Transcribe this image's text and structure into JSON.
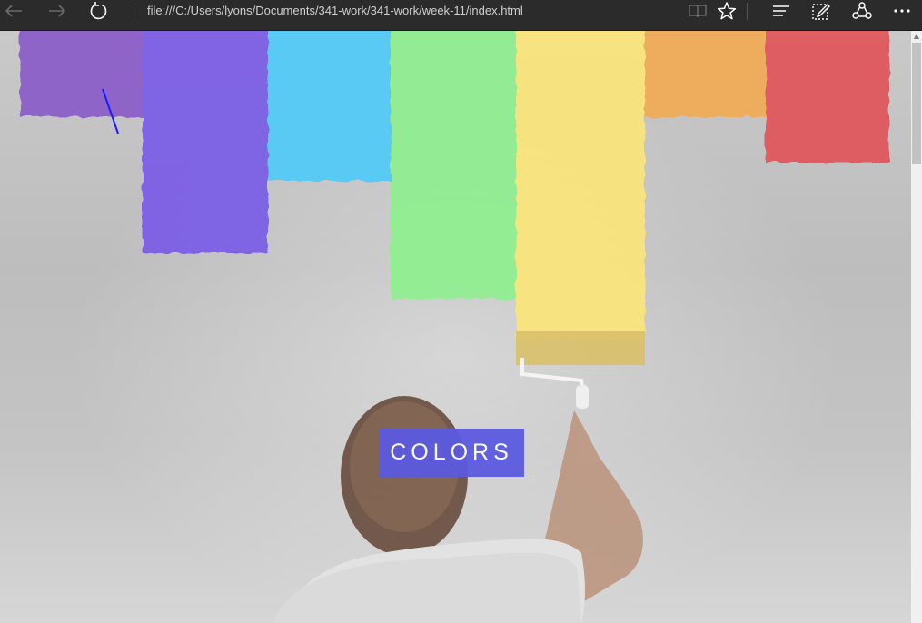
{
  "browser": {
    "address_url": "file:///C:/Users/lyons/Documents/341-work/341-work/week-11/index.html"
  },
  "page": {
    "button_label": "COLORS"
  },
  "colors": {
    "purple": "#8a5cc9",
    "violet": "#7a5ce6",
    "sky": "#4fcbf7",
    "green": "#8ff08f",
    "yellow": "#fbe67a",
    "orange": "#f2aa55",
    "red": "#e0545a",
    "button": "#5c5ae0"
  }
}
